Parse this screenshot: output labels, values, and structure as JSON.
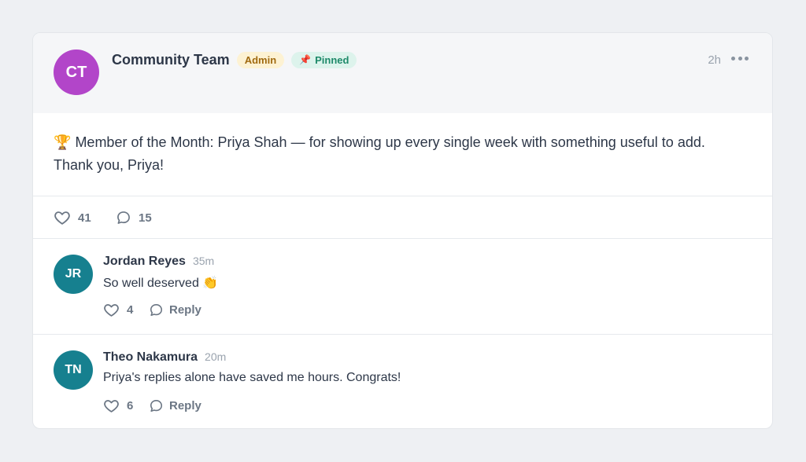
{
  "colors": {
    "page_background": "#eef0f3",
    "author_avatar": "#b245c9",
    "commenter_avatar": "#16808f",
    "admin_badge_bg": "#fdf2d3",
    "pinned_badge_bg": "#ddf3ec"
  },
  "post": {
    "author": {
      "initials": "CT",
      "name": "Community Team",
      "avatar_color": "#b245c9"
    },
    "badges": {
      "role": "Admin",
      "pinned_icon": "📌",
      "pinned": "Pinned"
    },
    "time": "2h",
    "more_icon": "more-horizontal-icon",
    "body": {
      "icon": "🏆",
      "line1": "Member of the Month: Priya Shah — for showing up every single week with something useful to add.",
      "line2": "Thank you, Priya!"
    },
    "likes": "41",
    "comments": "15"
  },
  "comments": [
    {
      "initials": "JR",
      "author": "Jordan Reyes",
      "time": "35m",
      "text": "So well deserved 👏",
      "likes": "4",
      "reply_label": "Reply"
    },
    {
      "initials": "TN",
      "author": "Theo Nakamura",
      "time": "20m",
      "text": "Priya's replies alone have saved me hours. Congrats!",
      "likes": "6",
      "reply_label": "Reply"
    }
  ]
}
